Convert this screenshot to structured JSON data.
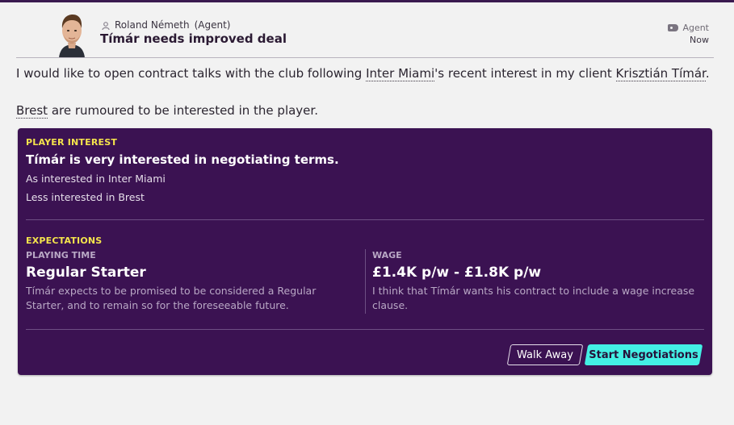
{
  "header": {
    "sender_name": "Roland Németh",
    "sender_role": "(Agent)",
    "subject": "Tímár needs improved deal",
    "tag": "Agent",
    "time": "Now"
  },
  "message": {
    "line1_prefix": "I would like to open contract talks with the club following ",
    "club_link": "Inter Miami",
    "line1_middle": "'s recent interest in my client ",
    "player_link": "Krisztián Tímár",
    "line1_suffix": ".",
    "rival_link": "Brest",
    "line2_suffix": " are rumoured to be interested in the player."
  },
  "card": {
    "interest_title": "PLAYER INTEREST",
    "interest_headline": "Tímár is very interested in negotiating terms.",
    "interest_line1": "As interested in Inter Miami",
    "interest_line2": "Less interested in Brest",
    "expectations_title": "EXPECTATIONS",
    "playing_time_label": "PLAYING TIME",
    "playing_time_value": "Regular Starter",
    "playing_time_desc": "Tímár expects to be promised to be considered a Regular Starter, and to remain so for the foreseeable future.",
    "wage_label": "WAGE",
    "wage_value": "£1.4K p/w - £1.8K p/w",
    "wage_desc": "I think that Tímár wants his contract to include a wage increase clause."
  },
  "buttons": {
    "walk_away": "Walk Away",
    "start_negotiations": "Start Negotiations"
  },
  "colors": {
    "card_bg": "#3b1252",
    "section_title": "#f4e44c",
    "primary_button": "#43f0e4"
  }
}
